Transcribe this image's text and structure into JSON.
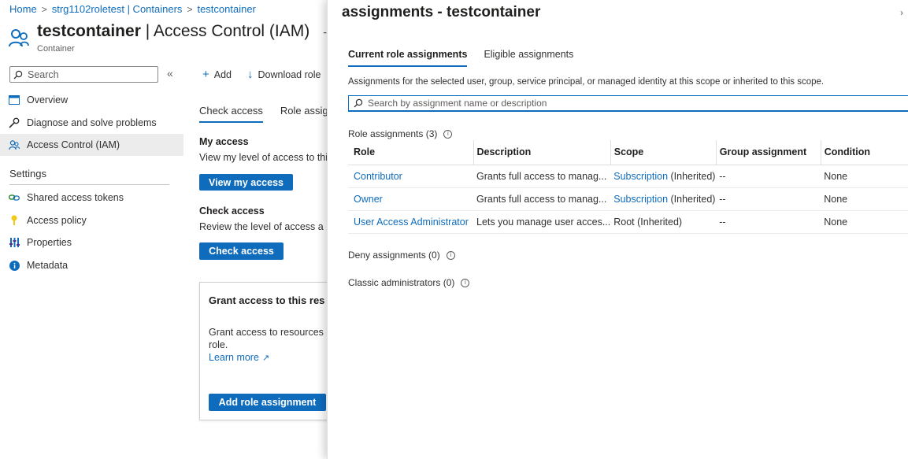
{
  "breadcrumb": {
    "items": [
      "Home",
      "strg1102roletest | Containers",
      "testcontainer"
    ],
    "separator": ">"
  },
  "page": {
    "title_name": "testcontainer",
    "title_rest": " | Access Control (IAM)",
    "subtitle": "Container"
  },
  "sidebar": {
    "search_placeholder": "Search",
    "collapse_glyph": "«",
    "items": [
      {
        "label": "Overview",
        "icon": "overview-icon"
      },
      {
        "label": "Diagnose and solve problems",
        "icon": "wrench-icon"
      },
      {
        "label": "Access Control (IAM)",
        "icon": "people-icon"
      }
    ],
    "settings_heading": "Settings",
    "settings_items": [
      {
        "label": "Shared access tokens",
        "icon": "link-icon"
      },
      {
        "label": "Access policy",
        "icon": "key-icon"
      },
      {
        "label": "Properties",
        "icon": "properties-icon"
      },
      {
        "label": "Metadata",
        "icon": "info-icon"
      }
    ]
  },
  "main": {
    "toolbar": {
      "add": "Add",
      "download": "Download role"
    },
    "tabs": [
      "Check access",
      "Role assignm"
    ],
    "my_access": {
      "heading": "My access",
      "text": "View my level of access to this r",
      "button": "View my access"
    },
    "check_access": {
      "heading": "Check access",
      "text": "Review the level of access a use",
      "button": "Check access"
    },
    "grant": {
      "title": "Grant access to this res",
      "text1": "Grant access to resources by",
      "text2": "role.",
      "learn_more": "Learn more",
      "button": "Add role assignment"
    }
  },
  "panel": {
    "title": "assignments - testcontainer",
    "close_glyph": "›",
    "tabs": [
      "Current role assignments",
      "Eligible assignments"
    ],
    "description": "Assignments for the selected user, group, service principal, or managed identity at this scope or inherited to this scope.",
    "search_placeholder": "Search by assignment name or description",
    "role_assignments_label": "Role assignments (3)",
    "columns": [
      "Role",
      "Description",
      "Scope",
      "Group assignment",
      "Condition"
    ],
    "rows": [
      {
        "role": "Contributor",
        "description": "Grants full access to manag...",
        "scope_link": "Subscription",
        "scope_suffix": " (Inherited)",
        "group": "--",
        "condition": "None"
      },
      {
        "role": "Owner",
        "description": "Grants full access to manag...",
        "scope_link": "Subscription",
        "scope_suffix": " (Inherited)",
        "group": "--",
        "condition": "None"
      },
      {
        "role": "User Access Administrator",
        "description": "Lets you manage user acces...",
        "scope_link": "",
        "scope_suffix": "Root (Inherited)",
        "group": "--",
        "condition": "None"
      }
    ],
    "deny_label": "Deny assignments (0)",
    "classic_label": "Classic administrators (0)"
  },
  "colors": {
    "accent": "#0f6cbd",
    "active_bg": "#ececec"
  }
}
